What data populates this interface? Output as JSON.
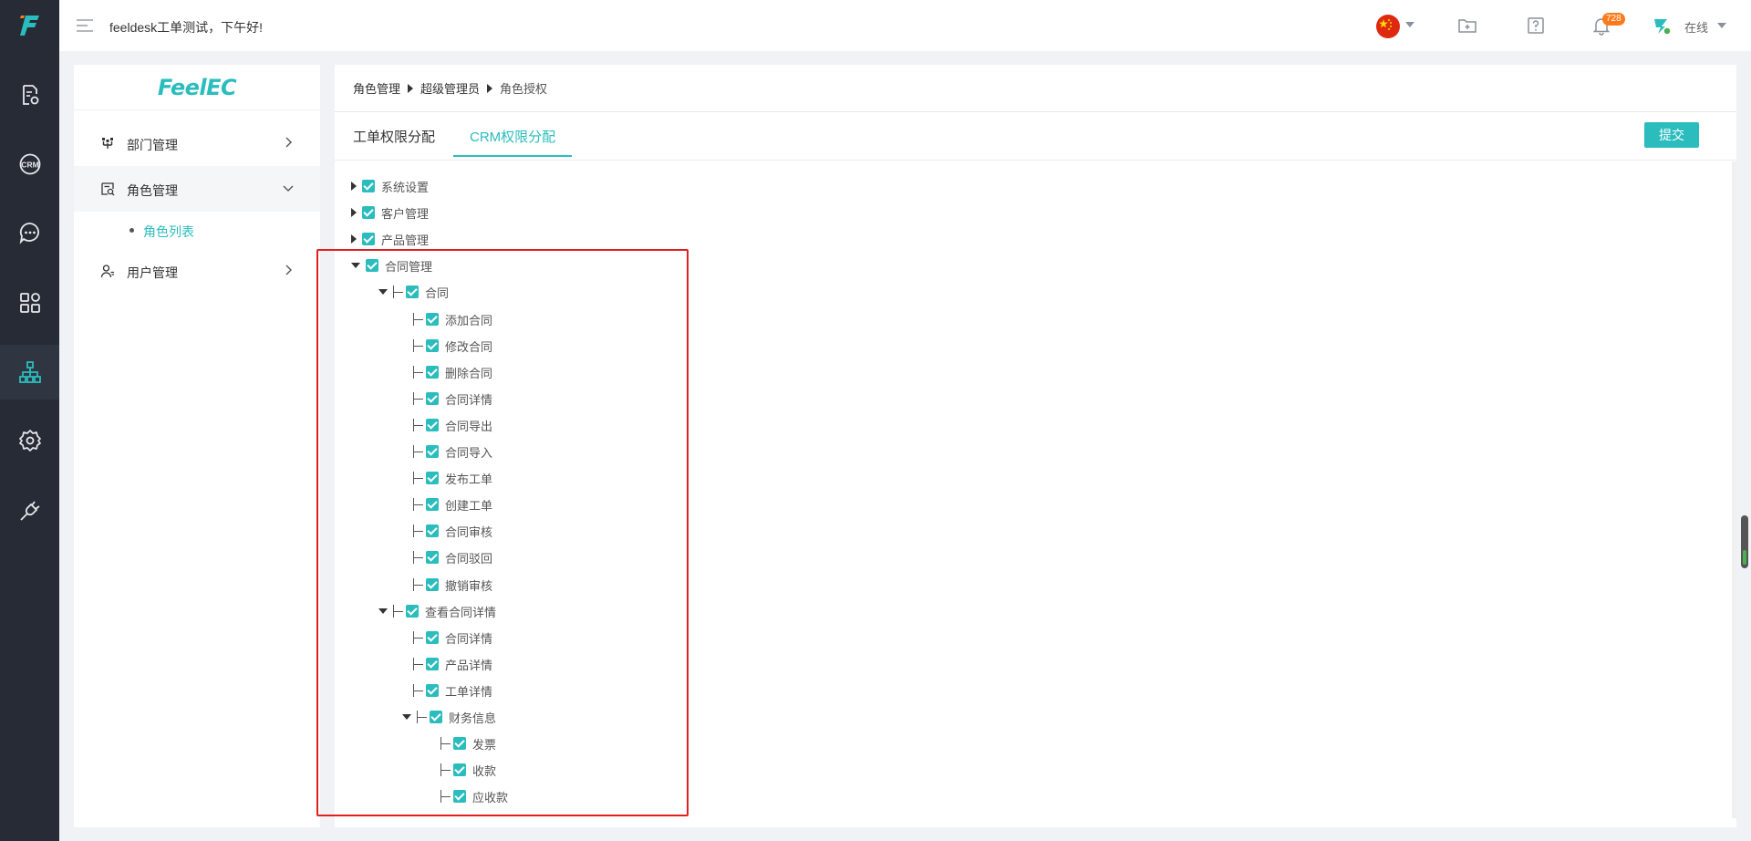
{
  "topbar": {
    "greeting": "feeldesk工单测试，下午好!",
    "notification_count": "728",
    "status": "在线"
  },
  "rail": {
    "items": [
      "file-settings-icon",
      "crm-icon",
      "chat-icon",
      "apps-icon",
      "org-chart-icon",
      "settings-icon",
      "plugin-icon"
    ],
    "crm_text": "CRM",
    "active_index": 4
  },
  "sidenav": {
    "brand": "FeelEC",
    "items": [
      {
        "label": "部门管理"
      },
      {
        "label": "角色管理"
      },
      {
        "label": "用户管理"
      }
    ],
    "sub_item": "角色列表"
  },
  "breadcrumb": [
    "角色管理",
    "超级管理员",
    "角色授权"
  ],
  "tabs": [
    {
      "label": "工单权限分配"
    },
    {
      "label": "CRM权限分配"
    }
  ],
  "submit_label": "提交",
  "tree": [
    {
      "label": "系统设置",
      "depth": 0,
      "toggle": "collapsed"
    },
    {
      "label": "客户管理",
      "depth": 0,
      "toggle": "collapsed"
    },
    {
      "label": "产品管理",
      "depth": 0,
      "toggle": "collapsed"
    },
    {
      "label": "合同管理",
      "depth": 0,
      "toggle": "expanded"
    },
    {
      "label": "合同",
      "depth": 1,
      "toggle": "expanded"
    },
    {
      "label": "添加合同",
      "depth": 2,
      "toggle": "none"
    },
    {
      "label": "修改合同",
      "depth": 2,
      "toggle": "none"
    },
    {
      "label": "删除合同",
      "depth": 2,
      "toggle": "none"
    },
    {
      "label": "合同详情",
      "depth": 2,
      "toggle": "none"
    },
    {
      "label": "合同导出",
      "depth": 2,
      "toggle": "none"
    },
    {
      "label": "合同导入",
      "depth": 2,
      "toggle": "none"
    },
    {
      "label": "发布工单",
      "depth": 2,
      "toggle": "none"
    },
    {
      "label": "创建工单",
      "depth": 2,
      "toggle": "none"
    },
    {
      "label": "合同审核",
      "depth": 2,
      "toggle": "none"
    },
    {
      "label": "合同驳回",
      "depth": 2,
      "toggle": "none"
    },
    {
      "label": "撤销审核",
      "depth": 2,
      "toggle": "none"
    },
    {
      "label": "查看合同详情",
      "depth": 1,
      "toggle": "expanded"
    },
    {
      "label": "合同详情",
      "depth": 2,
      "toggle": "none"
    },
    {
      "label": "产品详情",
      "depth": 2,
      "toggle": "none"
    },
    {
      "label": "工单详情",
      "depth": 2,
      "toggle": "none"
    },
    {
      "label": "财务信息",
      "depth": 2,
      "toggle": "expanded"
    },
    {
      "label": "发票",
      "depth": 3,
      "toggle": "none"
    },
    {
      "label": "收款",
      "depth": 3,
      "toggle": "none"
    },
    {
      "label": "应收款",
      "depth": 3,
      "toggle": "none"
    }
  ],
  "colors": {
    "accent": "#2bbdbd",
    "rail_bg": "#262b35",
    "highlight": "#e02020",
    "badge": "#ff7a1a"
  }
}
